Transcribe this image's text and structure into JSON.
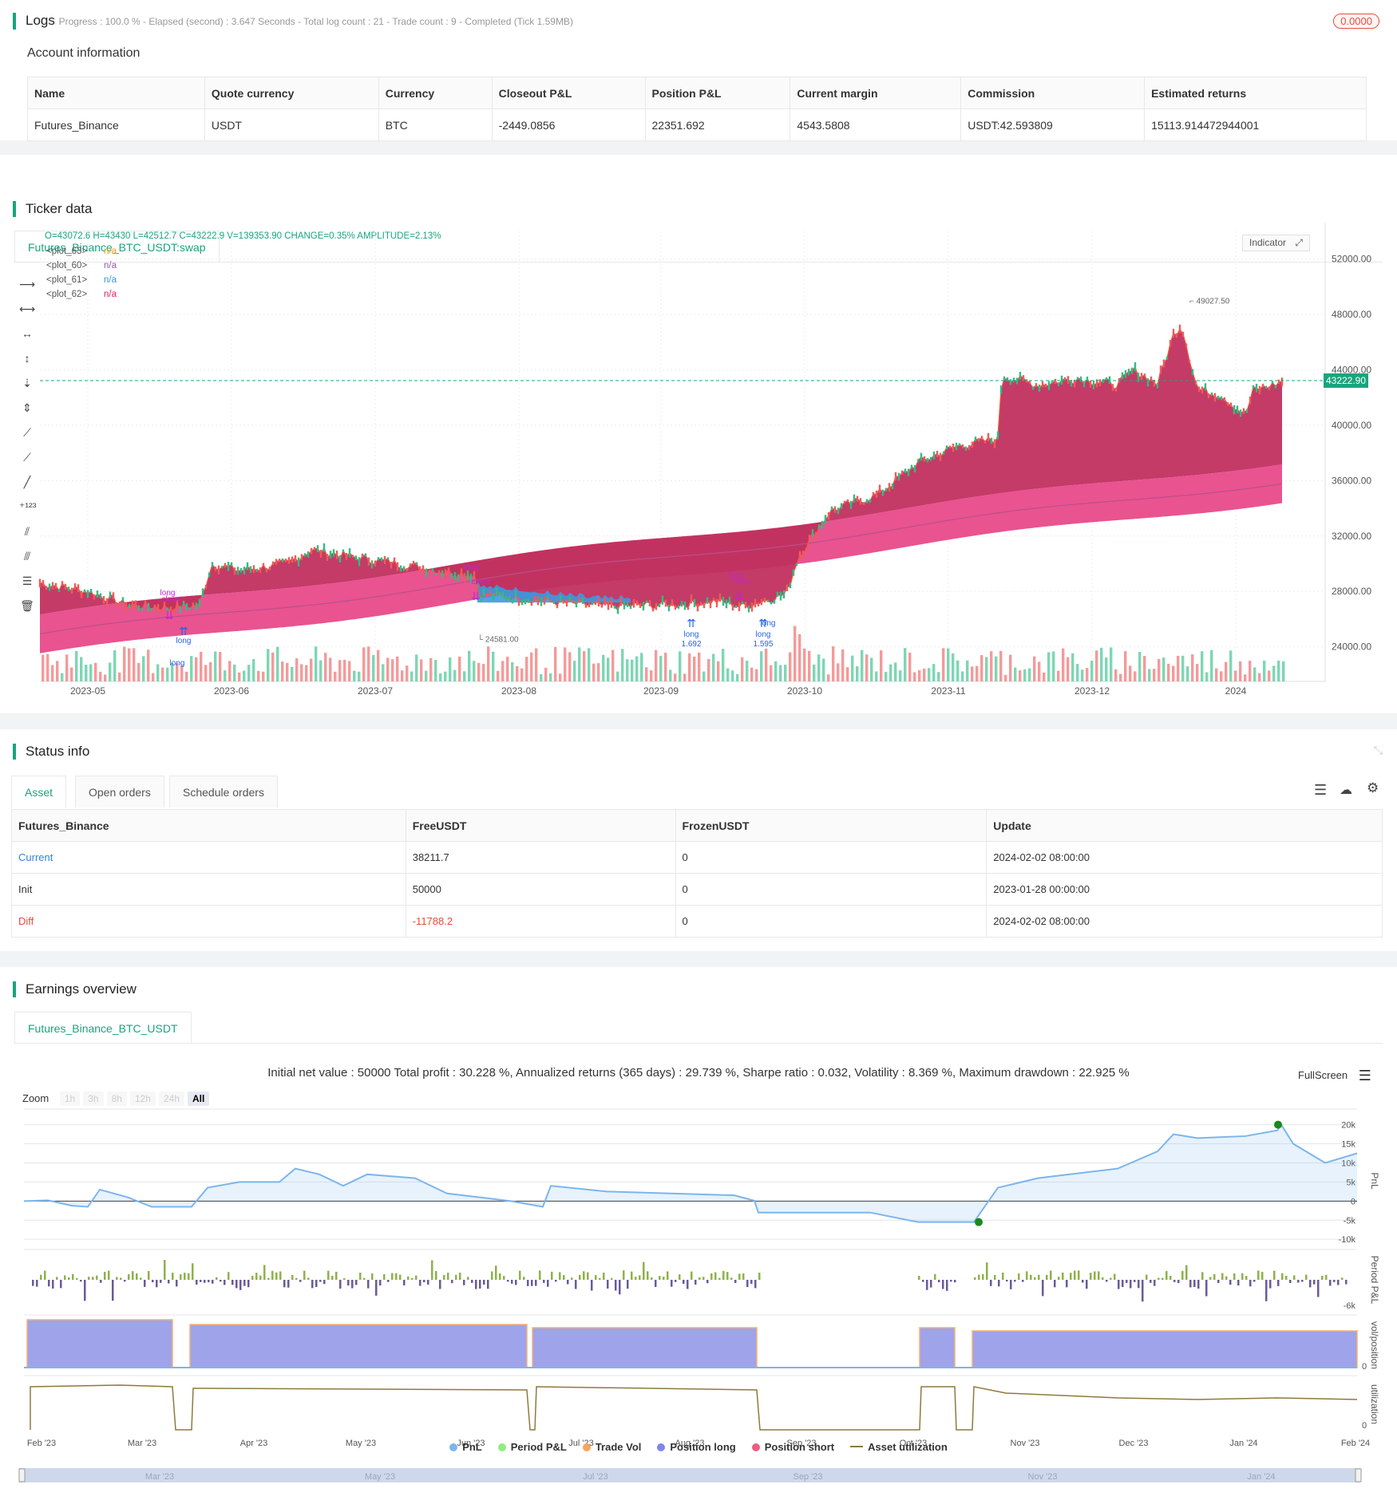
{
  "logs": {
    "title": "Logs",
    "meta": "Progress : 100.0 % - Elapsed (second) : 3.647  Seconds - Total log count : 21 - Trade count : 9 - Completed (Tick 1.59MB)",
    "badge": "0.0000"
  },
  "account": {
    "title": "Account information",
    "headers": [
      "Name",
      "Quote currency",
      "Currency",
      "Closeout P&L",
      "Position P&L",
      "Current margin",
      "Commission",
      "Estimated returns"
    ],
    "row": [
      "Futures_Binance",
      "USDT",
      "BTC",
      "-2449.0856",
      "22351.692",
      "4543.5808",
      "USDT:42.593809",
      "15113.914472944001"
    ]
  },
  "ticker": {
    "title": "Ticker data",
    "tab": "Futures_Binance_BTC_USDT:swap",
    "ohlc": "O=43072.6 H=43430 L=42512.7 C=43222.9 V=139353.90 CHANGE=0.35% AMPLITUDE=2.13%",
    "legend": [
      {
        "name": "<plot_63>",
        "value": "n/a",
        "color": "#f39c12"
      },
      {
        "name": "<plot_60>",
        "value": "n/a",
        "color": "#9b59b6"
      },
      {
        "name": "<plot_61>",
        "value": "n/a",
        "color": "#3498db"
      },
      {
        "name": "<plot_62>",
        "value": "n/a",
        "color": "#e91e63"
      }
    ],
    "indicator_label": "Indicator",
    "price_label": "43222.90",
    "high_label": "49027.50",
    "low_label": "24581.00",
    "y_ticks": [
      "52000.00",
      "48000.00",
      "44000.00",
      "40000.00",
      "36000.00",
      "32000.00",
      "28000.00",
      "24000.00"
    ],
    "x_ticks": [
      "2023-05",
      "2023-06",
      "2023-07",
      "2023-08",
      "2023-09",
      "2023-10",
      "2023-11",
      "2023-12",
      "2024"
    ],
    "annotations": [
      {
        "text": "long",
        "color": "#c026d3"
      },
      {
        "text": "close",
        "color": "#c026d3"
      },
      {
        "text": "long",
        "color": "#2563eb"
      },
      {
        "text": "1.692",
        "color": "#2563eb"
      },
      {
        "text": "1.595",
        "color": "#2563eb"
      }
    ]
  },
  "status": {
    "title": "Status info",
    "tabs": [
      "Asset",
      "Open orders",
      "Schedule orders"
    ],
    "headers": [
      "Futures_Binance",
      "FreeUSDT",
      "FrozenUSDT",
      "Update"
    ],
    "rows": [
      [
        "Current",
        "38211.7",
        "0",
        "2024-02-02 08:00:00"
      ],
      [
        "Init",
        "50000",
        "0",
        "2023-01-28 00:00:00"
      ],
      [
        "Diff",
        "-11788.2",
        "0",
        "2024-02-02 08:00:00"
      ]
    ]
  },
  "earnings": {
    "title": "Earnings overview",
    "tab": "Futures_Binance_BTC_USDT",
    "summary": "Initial net value : 50000 Total profit : 30.228 %, Annualized returns (365 days) : 29.739 %, Sharpe ratio : 0.032, Volatility : 8.369 %, Maximum drawdown : 22.925 %",
    "fullscreen": "FullScreen",
    "zoom_label": "Zoom",
    "zoom_options": [
      "1h",
      "3h",
      "8h",
      "12h",
      "24h",
      "All"
    ],
    "pnl_ticks": [
      "20k",
      "15k",
      "10k",
      "5k",
      "0",
      "-5k",
      "-10k"
    ],
    "period_tick": "-6k",
    "vol_tick": "0",
    "util_tick": "0",
    "axis_titles": [
      "PnL",
      "Period P&L",
      "vol/position",
      "utilization"
    ],
    "x_ticks": [
      "Feb '23",
      "Mar '23",
      "Apr '23",
      "May '23",
      "Jun '23",
      "Jul '23",
      "Aug '23",
      "Sep '23",
      "Oct '23",
      "Nov '23",
      "Dec '23",
      "Jan '24",
      "Feb '24"
    ],
    "nav_ticks": [
      "Mar '23",
      "May '23",
      "Jul '23",
      "Sep '23",
      "Nov '23",
      "Jan '24"
    ],
    "legend": [
      {
        "name": "PnL",
        "color": "#7cb5ec"
      },
      {
        "name": "Period P&L",
        "color": "#90ed7d"
      },
      {
        "name": "Trade Vol",
        "color": "#f7a35c"
      },
      {
        "name": "Position long",
        "color": "#8085e9"
      },
      {
        "name": "Position short",
        "color": "#f15c80"
      },
      {
        "name": "Asset utilization",
        "color": "#8d7a3a"
      }
    ]
  }
}
